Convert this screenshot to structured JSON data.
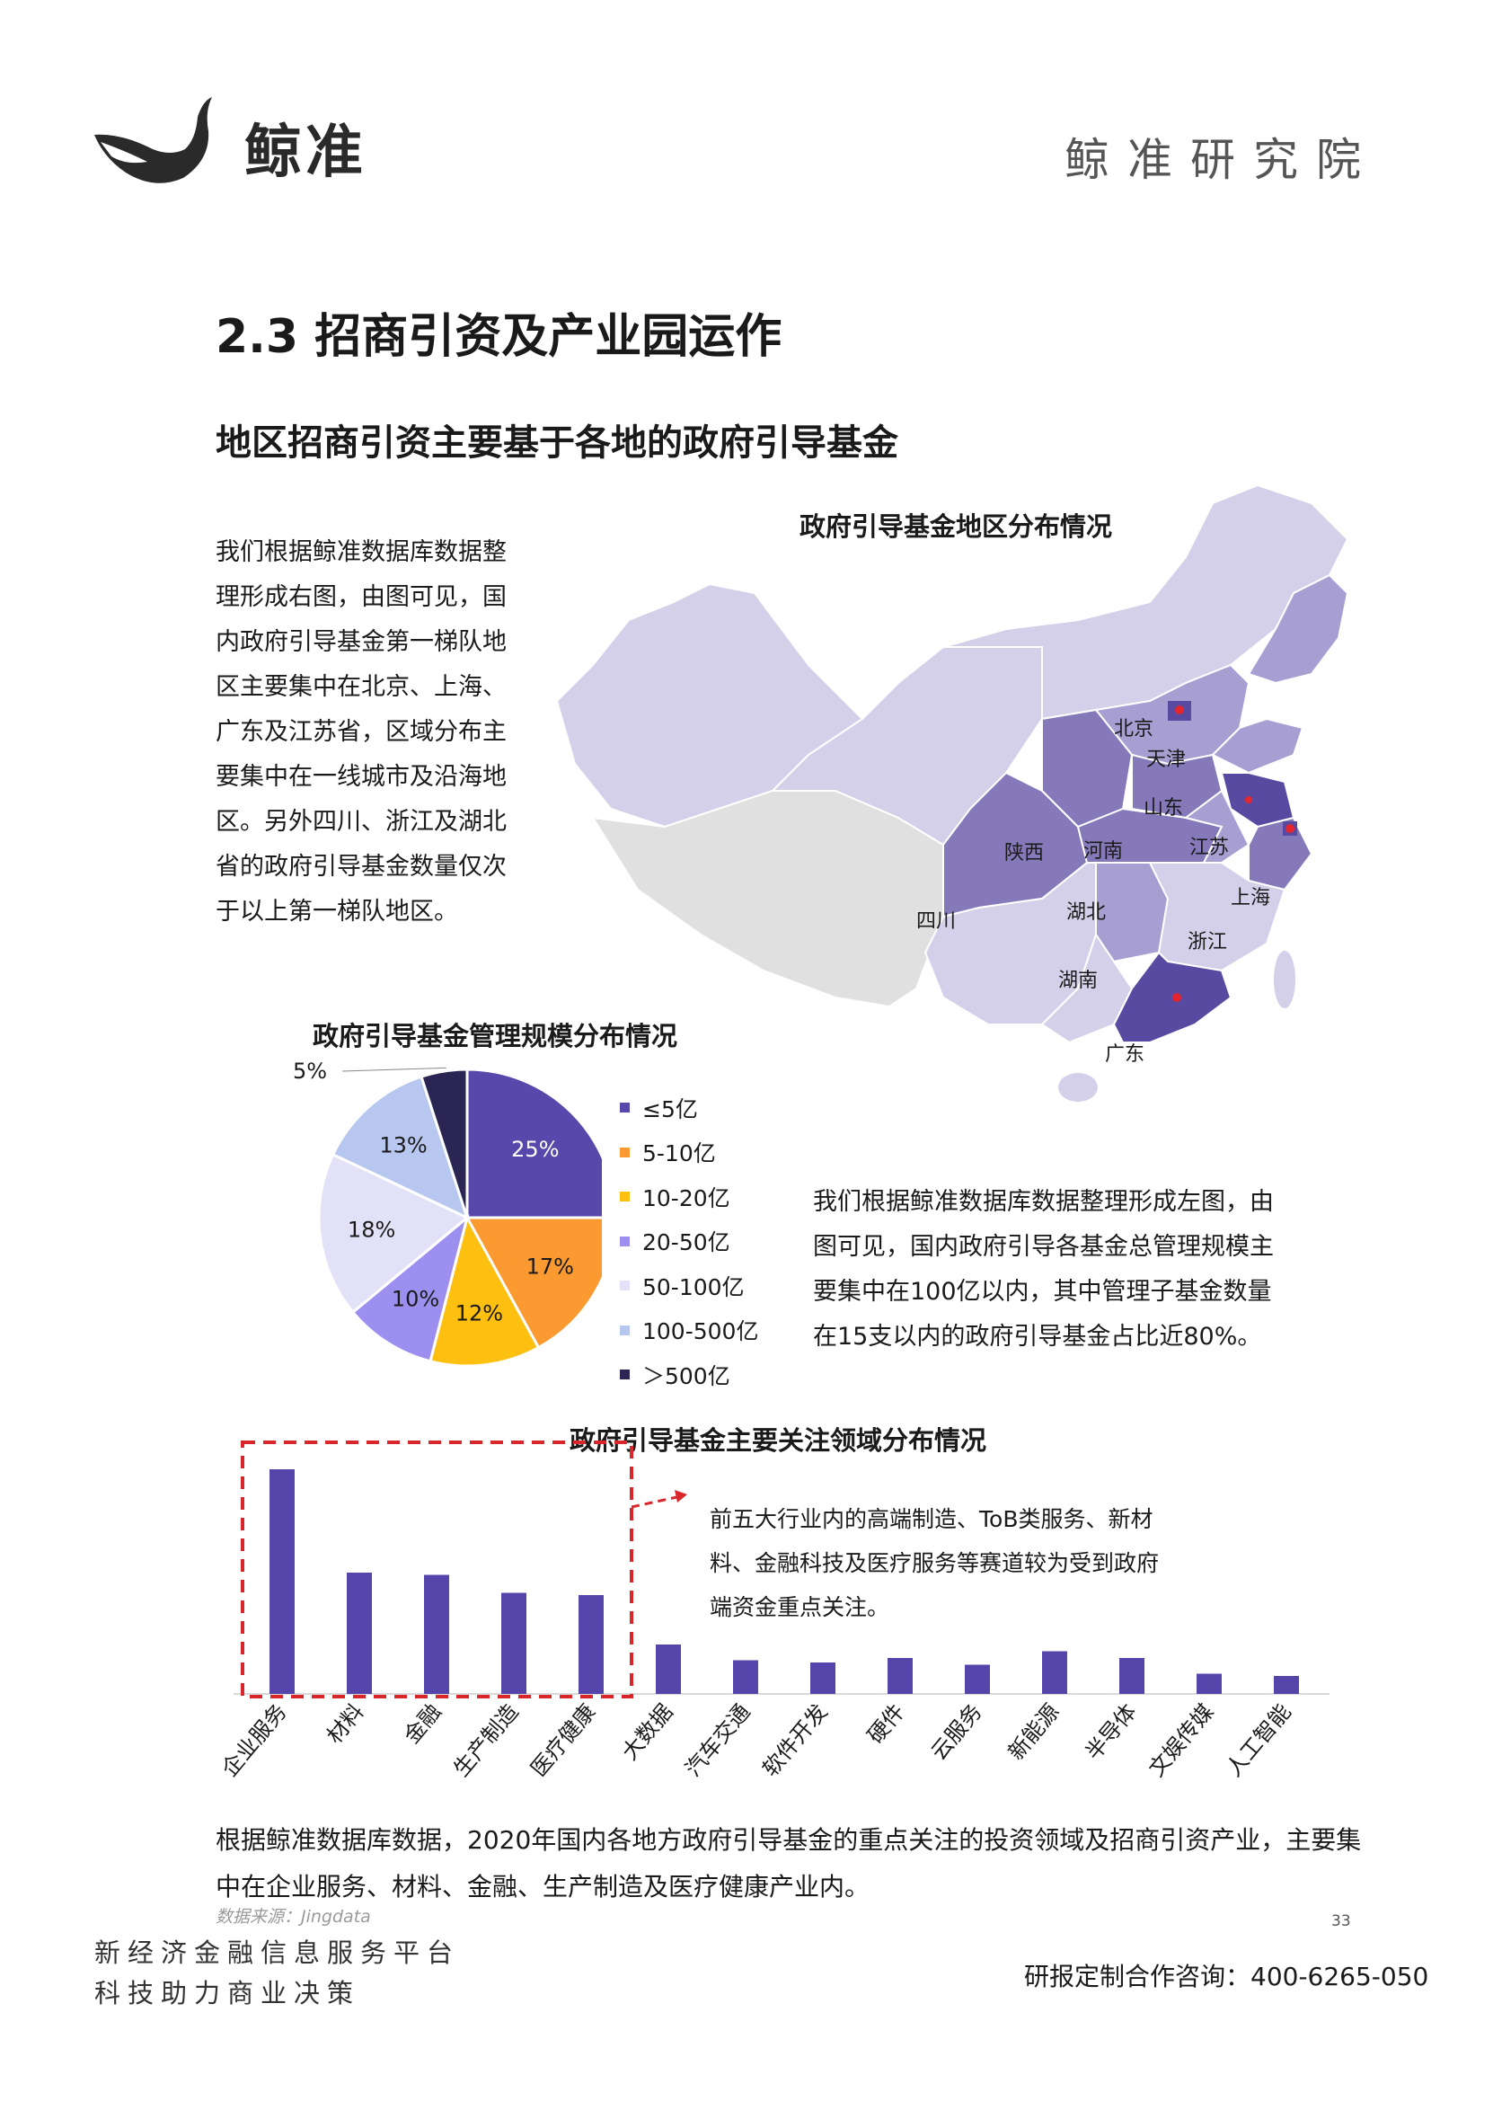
{
  "header": {
    "brand_name": "鲸准",
    "institute": "鲸准研究院"
  },
  "section_title": "2.3 招商引资及产业园运作",
  "subtitle": "地区招商引资主要基于各地的政府引导基金",
  "para_left": "我们根据鲸准数据库数据整理形成右图，由图可见，国内政府引导基金第一梯队地区主要集中在北京、上海、广东及江苏省，区域分布主要集中在一线城市及沿海地区。另外四川、浙江及湖北省的政府引导基金数量仅次于以上第一梯队地区。",
  "map": {
    "title": "政府引导基金地区分布情况",
    "labels": [
      "北京",
      "天津",
      "山东",
      "江苏",
      "上海",
      "陕西",
      "河南",
      "四川",
      "湖北",
      "浙江",
      "湖南",
      "广东"
    ]
  },
  "pie_chart_title": "政府引导基金管理规模分布情况",
  "para_right": "我们根据鲸准数据库数据整理形成左图，由图可见，国内政府引导各基金总管理规模主要集中在100亿以内，其中管理子基金数量在15支以内的政府引导基金占比近80%。",
  "bar_chart_title": "政府引导基金主要关注领域分布情况",
  "annotation": "前五大行业内的高端制造、ToB类服务、新材料、金融科技及医疗服务等赛道较为受到政府端资金重点关注。",
  "para_bottom": "根据鲸准数据库数据，2020年国内各地方政府引导基金的重点关注的投资领域及招商引资产业，主要集中在企业服务、材料、金融、生产制造及医疗健康产业内。",
  "source": "数据来源：Jingdata",
  "page_number": "33",
  "footer": {
    "line1": "新经济金融信息服务平台",
    "line2": "科技助力商业决策",
    "contact": "研报定制合作咨询：400-6265-050"
  },
  "colors": {
    "map_light": "#d4d0ea",
    "map_mid": "#a79fd2",
    "map_dark": "#8579ba",
    "map_darkest": "#574aa0",
    "map_gray": "#e0e0e0",
    "bar": "#5545aa",
    "highlight_box": "#d9262b"
  },
  "chart_data": [
    {
      "type": "pie",
      "title": "政府引导基金管理规模分布情况",
      "labels": [
        "≤5亿",
        "5-10亿",
        "10-20亿",
        "20-50亿",
        "50-100亿",
        "100-500亿",
        "＞500亿"
      ],
      "values": [
        25,
        17,
        12,
        10,
        18,
        13,
        5
      ],
      "value_labels": [
        "25%",
        "17%",
        "12%",
        "10%",
        "18%",
        "13%",
        "5%"
      ],
      "colors": [
        "#5848ab",
        "#fb9a31",
        "#fdbf10",
        "#9c8ff0",
        "#e3e1f7",
        "#b8c7ef",
        "#2a2552"
      ],
      "legend_position": "right"
    },
    {
      "type": "bar",
      "title": "政府引导基金主要关注领域分布情况",
      "categories": [
        "企业服务",
        "材料",
        "金融",
        "生产制造",
        "医疗健康",
        "大数据",
        "汽车交通",
        "软件开发",
        "硬件",
        "云服务",
        "新能源",
        "半导体",
        "文娱传媒",
        "人工智能"
      ],
      "values": [
        100,
        54,
        53,
        45,
        44,
        22,
        15,
        14,
        16,
        13,
        19,
        16,
        9,
        8
      ],
      "y_axis": "none",
      "highlight_first_n": 5
    }
  ]
}
